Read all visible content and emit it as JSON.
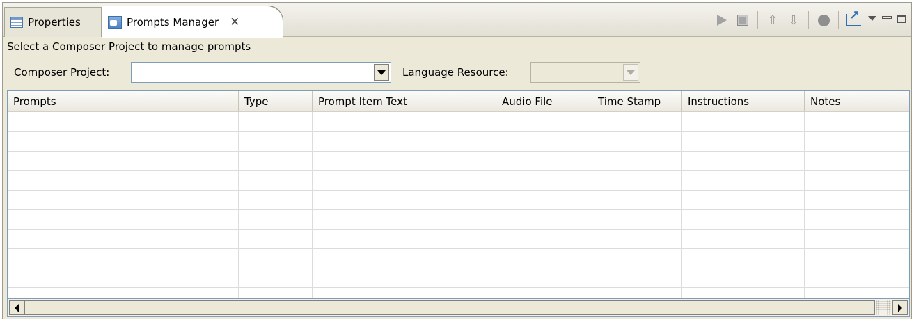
{
  "tabs": [
    {
      "label": "Properties",
      "icon": "properties-table-icon",
      "active": false
    },
    {
      "label": "Prompts Manager",
      "icon": "prompts-manager-icon",
      "active": true,
      "closable": true
    }
  ],
  "tab_close_glyph": "✕",
  "toolbar": {
    "buttons": [
      "play-icon",
      "stop-icon",
      "move-up-icon",
      "move-down-icon",
      "record-icon",
      "export-icon",
      "view-menu-icon",
      "minimize-icon",
      "maximize-icon"
    ],
    "up_glyph": "⇧",
    "down_glyph": "⇩"
  },
  "description": "Select a Composer Project to manage prompts",
  "form": {
    "project_label": "Composer Project:",
    "project_value": "",
    "language_label": "Language Resource:",
    "language_value": "",
    "language_enabled": false
  },
  "table": {
    "columns": [
      "Prompts",
      "Type",
      "Prompt Item Text",
      "Audio File",
      "Time Stamp",
      "Instructions",
      "Notes"
    ],
    "rows": []
  }
}
